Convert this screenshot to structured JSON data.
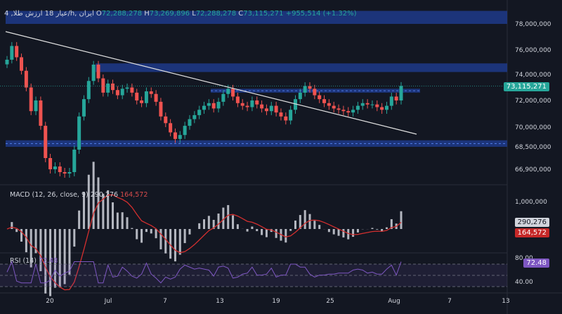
{
  "header": {
    "title": "4 ,عیار 18 ارزش طلا/h, ایران",
    "open_label": "O",
    "open": "72,288,278",
    "high_label": "H",
    "high": "73,269,896",
    "low_label": "L",
    "low": "72,288,278",
    "close_label": "C",
    "close": "73,115,271",
    "change": "+955,514 (+1.32%)"
  },
  "price_axis": [
    "78,000,000",
    "76,000,000",
    "74,000,000",
    "72,000,000",
    "70,000,000",
    "68,500,000",
    "66,900,000"
  ],
  "price_tag": "73,115,271",
  "macd": {
    "label": "MACD (12, 26, close, 9)",
    "v1": "290,276",
    "v2": "164,572",
    "axis": [
      "1,000,000"
    ],
    "tag1": "290,276",
    "tag2": "164,572"
  },
  "rsi": {
    "label": "RSI (14)",
    "value": "72.48",
    "axis": [
      "80.00",
      "40.00"
    ],
    "tag": "72.48"
  },
  "time_axis": [
    "20",
    "Jul",
    "7",
    "13",
    "19",
    "25",
    "Aug",
    "7",
    "13"
  ],
  "colors": {
    "up": "#26a69a",
    "down": "#ef5350",
    "zone": "#1e3a8a",
    "trend": "#e0e0e0",
    "macd_hist": "#d1d4dc",
    "signal": "#d32f2f",
    "rsi": "#7e57c2",
    "bg": "#131722"
  },
  "chart_data": {
    "type": "candlestick",
    "ylim": [
      65500000,
      79500000
    ],
    "close_path": [
      75200000,
      76300000,
      75400000,
      74300000,
      73000000,
      71200000,
      72000000,
      70100000,
      67700000,
      66900000,
      67100000,
      66700000,
      66600000,
      66700000,
      68300000,
      70800000,
      72100000,
      73500000,
      74800000,
      73700000,
      72600000,
      73300000,
      72800000,
      72400000,
      72900000,
      73000000,
      72600000,
      72000000,
      71800000,
      72700000,
      72500000,
      71900000,
      70800000,
      70300000,
      69600000,
      69100000,
      69400000,
      70100000,
      70600000,
      70900000,
      71300000,
      71600000,
      71800000,
      71400000,
      71900000,
      72500000,
      72900000,
      72300000,
      71800000,
      71600000,
      71500000,
      72000000,
      71700000,
      71400000,
      71200000,
      71600000,
      71100000,
      70800000,
      70500000,
      71300000,
      72100000,
      72600000,
      73100000,
      72900000,
      72400000,
      72100000,
      71800000,
      71600000,
      71400000,
      71300000,
      71200000,
      71100000,
      71300000,
      71600000,
      71800000,
      71700000,
      71700000,
      71500000,
      71300000,
      71600000,
      72300000,
      72000000,
      73115271
    ],
    "zones": [
      {
        "name": "upper-zone",
        "from": 78000000,
        "to": 79000000
      },
      {
        "name": "resistance-zone",
        "from": 74200000,
        "to": 74900000
      },
      {
        "name": "mid-zone",
        "from": 72600000,
        "to": 72900000
      },
      {
        "name": "support-zone",
        "from": 68500000,
        "to": 69000000
      }
    ]
  }
}
